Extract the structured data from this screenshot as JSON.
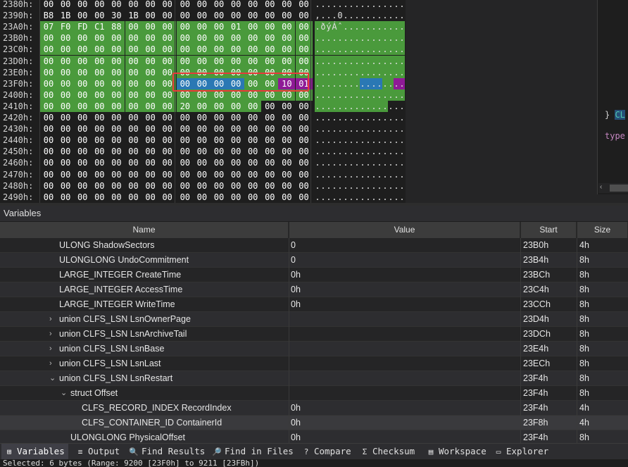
{
  "hex": {
    "rows": [
      {
        "offset": "2380h:",
        "bytes": [
          "00",
          "00",
          "00",
          "00",
          "00",
          "00",
          "00",
          "00",
          "00",
          "00",
          "00",
          "00",
          "00",
          "00",
          "00",
          "00"
        ],
        "ascii": "................"
      },
      {
        "offset": "2390h:",
        "bytes": [
          "B8",
          "1B",
          "00",
          "00",
          "30",
          "1B",
          "00",
          "00",
          "00",
          "00",
          "00",
          "00",
          "00",
          "00",
          "00",
          "00"
        ],
        "ascii": ",...0..........."
      },
      {
        "offset": "23A0h:",
        "bytes": [
          "07",
          "F0",
          "FD",
          "C1",
          "88",
          "00",
          "00",
          "00",
          "00",
          "00",
          "00",
          "01",
          "00",
          "00",
          "00",
          "00"
        ],
        "ascii": ".ðýÁˆ..........."
      },
      {
        "offset": "23B0h:",
        "bytes": [
          "00",
          "00",
          "00",
          "00",
          "00",
          "00",
          "00",
          "00",
          "00",
          "00",
          "00",
          "00",
          "00",
          "00",
          "00",
          "00"
        ],
        "ascii": "................"
      },
      {
        "offset": "23C0h:",
        "bytes": [
          "00",
          "00",
          "00",
          "00",
          "00",
          "00",
          "00",
          "00",
          "00",
          "00",
          "00",
          "00",
          "00",
          "00",
          "00",
          "00"
        ],
        "ascii": "................"
      },
      {
        "offset": "23D0h:",
        "bytes": [
          "00",
          "00",
          "00",
          "00",
          "00",
          "00",
          "00",
          "00",
          "00",
          "00",
          "00",
          "00",
          "00",
          "00",
          "00",
          "00"
        ],
        "ascii": "................"
      },
      {
        "offset": "23E0h:",
        "bytes": [
          "00",
          "00",
          "00",
          "00",
          "00",
          "00",
          "00",
          "00",
          "00",
          "00",
          "00",
          "00",
          "00",
          "00",
          "00",
          "00"
        ],
        "ascii": "................"
      },
      {
        "offset": "23F0h:",
        "bytes": [
          "00",
          "00",
          "00",
          "00",
          "00",
          "00",
          "00",
          "00",
          "00",
          "00",
          "00",
          "00",
          "00",
          "00",
          "10",
          "01"
        ],
        "ascii": "................"
      },
      {
        "offset": "2400h:",
        "bytes": [
          "00",
          "00",
          "00",
          "00",
          "00",
          "00",
          "00",
          "00",
          "00",
          "00",
          "00",
          "00",
          "00",
          "00",
          "00",
          "00"
        ],
        "ascii": "................"
      },
      {
        "offset": "2410h:",
        "bytes": [
          "00",
          "00",
          "00",
          "00",
          "00",
          "00",
          "00",
          "00",
          "20",
          "00",
          "00",
          "00",
          "00",
          "00",
          "00",
          "00"
        ],
        "ascii": "................"
      },
      {
        "offset": "2420h:",
        "bytes": [
          "00",
          "00",
          "00",
          "00",
          "00",
          "00",
          "00",
          "00",
          "00",
          "00",
          "00",
          "00",
          "00",
          "00",
          "00",
          "00"
        ],
        "ascii": "................"
      },
      {
        "offset": "2430h:",
        "bytes": [
          "00",
          "00",
          "00",
          "00",
          "00",
          "00",
          "00",
          "00",
          "00",
          "00",
          "00",
          "00",
          "00",
          "00",
          "00",
          "00"
        ],
        "ascii": "................"
      },
      {
        "offset": "2440h:",
        "bytes": [
          "00",
          "00",
          "00",
          "00",
          "00",
          "00",
          "00",
          "00",
          "00",
          "00",
          "00",
          "00",
          "00",
          "00",
          "00",
          "00"
        ],
        "ascii": "................"
      },
      {
        "offset": "2450h:",
        "bytes": [
          "00",
          "00",
          "00",
          "00",
          "00",
          "00",
          "00",
          "00",
          "00",
          "00",
          "00",
          "00",
          "00",
          "00",
          "00",
          "00"
        ],
        "ascii": "................"
      },
      {
        "offset": "2460h:",
        "bytes": [
          "00",
          "00",
          "00",
          "00",
          "00",
          "00",
          "00",
          "00",
          "00",
          "00",
          "00",
          "00",
          "00",
          "00",
          "00",
          "00"
        ],
        "ascii": "................"
      },
      {
        "offset": "2470h:",
        "bytes": [
          "00",
          "00",
          "00",
          "00",
          "00",
          "00",
          "00",
          "00",
          "00",
          "00",
          "00",
          "00",
          "00",
          "00",
          "00",
          "00"
        ],
        "ascii": "................"
      },
      {
        "offset": "2480h:",
        "bytes": [
          "00",
          "00",
          "00",
          "00",
          "00",
          "00",
          "00",
          "00",
          "00",
          "00",
          "00",
          "00",
          "00",
          "00",
          "00",
          "00"
        ],
        "ascii": "................"
      },
      {
        "offset": "2490h:",
        "bytes": [
          "00",
          "00",
          "00",
          "00",
          "00",
          "00",
          "00",
          "00",
          "00",
          "00",
          "00",
          "00",
          "00",
          "00",
          "00",
          "00"
        ],
        "ascii": "................"
      }
    ],
    "colors": {
      "struct": "#4a9a3c",
      "selection": "#2a78b4",
      "highlight": "#8e1a96",
      "annotation_box": "#e83a3a"
    }
  },
  "editor": {
    "brace": "} ",
    "selected_text": "CL",
    "keyword": "type"
  },
  "variables": {
    "panel_title": "Variables",
    "columns": {
      "name": "Name",
      "value": "Value",
      "start": "Start",
      "size": "Size"
    },
    "rows": [
      {
        "name": "ULONG ShadowSectors",
        "value": "0",
        "start": "23B0h",
        "size": "4h",
        "expander": ""
      },
      {
        "name": "ULONGLONG UndoCommitment",
        "value": "0",
        "start": "23B4h",
        "size": "8h",
        "expander": ""
      },
      {
        "name": "LARGE_INTEGER CreateTime",
        "value": "0h",
        "start": "23BCh",
        "size": "8h",
        "expander": ""
      },
      {
        "name": "LARGE_INTEGER AccessTime",
        "value": "0h",
        "start": "23C4h",
        "size": "8h",
        "expander": ""
      },
      {
        "name": "LARGE_INTEGER WriteTime",
        "value": "0h",
        "start": "23CCh",
        "size": "8h",
        "expander": ""
      },
      {
        "name": "union CLFS_LSN LsnOwnerPage",
        "value": "",
        "start": "23D4h",
        "size": "8h",
        "expander": "›"
      },
      {
        "name": "union CLFS_LSN LsnArchiveTail",
        "value": "",
        "start": "23DCh",
        "size": "8h",
        "expander": "›"
      },
      {
        "name": "union CLFS_LSN LsnBase",
        "value": "",
        "start": "23E4h",
        "size": "8h",
        "expander": "›"
      },
      {
        "name": "union CLFS_LSN LsnLast",
        "value": "",
        "start": "23ECh",
        "size": "8h",
        "expander": "›"
      },
      {
        "name": "union CLFS_LSN LsnRestart",
        "value": "",
        "start": "23F4h",
        "size": "8h",
        "expander": "⌄"
      },
      {
        "name": "struct Offset",
        "value": "",
        "start": "23F4h",
        "size": "8h",
        "expander": "⌄"
      },
      {
        "name": "CLFS_RECORD_INDEX RecordIndex",
        "value": "0h",
        "start": "23F4h",
        "size": "4h",
        "expander": ""
      },
      {
        "name": "CLFS_CONTAINER_ID ContainerId",
        "value": "0h",
        "start": "23F8h",
        "size": "4h",
        "expander": ""
      },
      {
        "name": "ULONGLONG PhysicalOffset",
        "value": "0h",
        "start": "23F4h",
        "size": "8h",
        "expander": ""
      }
    ]
  },
  "tabs": [
    {
      "label": "Variables",
      "icon": "variables-icon",
      "glyph": "⊞"
    },
    {
      "label": "Output",
      "icon": "output-icon",
      "glyph": "≡"
    },
    {
      "label": "Find Results",
      "icon": "find-results-icon",
      "glyph": "🔍"
    },
    {
      "label": "Find in Files",
      "icon": "find-in-files-icon",
      "glyph": "🔎"
    },
    {
      "label": "Compare",
      "icon": "compare-icon",
      "glyph": "?"
    },
    {
      "label": "Checksum",
      "icon": "checksum-icon",
      "glyph": "Σ"
    },
    {
      "label": "Workspace",
      "icon": "workspace-icon",
      "glyph": "▤"
    },
    {
      "label": "Explorer",
      "icon": "explorer-icon",
      "glyph": "▭"
    }
  ],
  "status": {
    "text": "Selected: 6 bytes (Range: 9200 [23F0h] to 9211 [23FBh])"
  }
}
